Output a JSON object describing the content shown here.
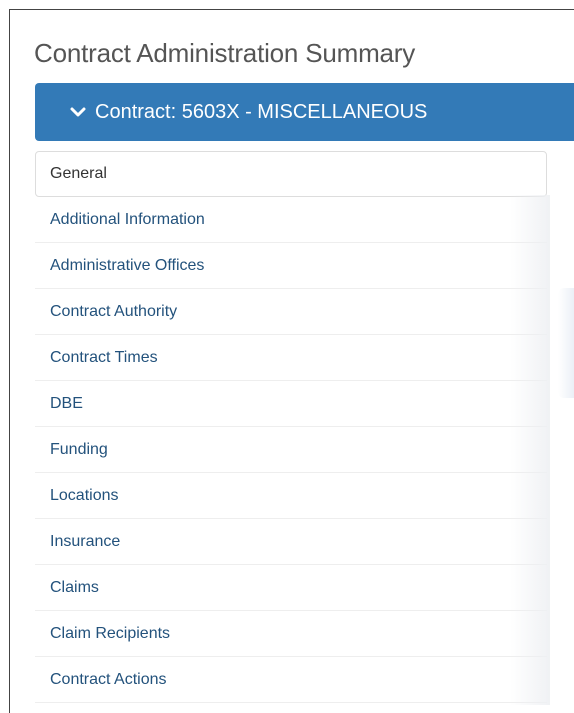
{
  "page": {
    "title": "Contract Administration Summary"
  },
  "panel": {
    "header_label": "Contract: 5603X - MISCELLANEOUS",
    "toggle_icon": "chevron-down-icon"
  },
  "nav": {
    "items": [
      {
        "label": "General",
        "active": true
      },
      {
        "label": "Additional Information",
        "active": false
      },
      {
        "label": "Administrative Offices",
        "active": false
      },
      {
        "label": "Contract Authority",
        "active": false
      },
      {
        "label": "Contract Times",
        "active": false
      },
      {
        "label": "DBE",
        "active": false
      },
      {
        "label": "Funding",
        "active": false
      },
      {
        "label": "Locations",
        "active": false
      },
      {
        "label": "Insurance",
        "active": false
      },
      {
        "label": "Claims",
        "active": false
      },
      {
        "label": "Claim Recipients",
        "active": false
      },
      {
        "label": "Contract Actions",
        "active": false
      }
    ]
  },
  "colors": {
    "header_bg": "#337ab7",
    "link": "#23527c",
    "title": "#555555"
  }
}
